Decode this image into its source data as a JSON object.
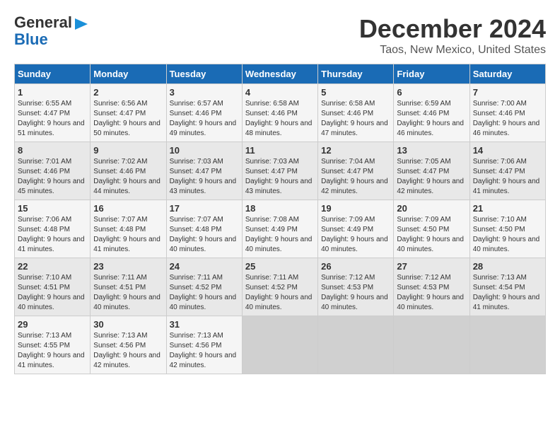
{
  "header": {
    "logo_general": "General",
    "logo_blue": "Blue",
    "title": "December 2024",
    "subtitle": "Taos, New Mexico, United States"
  },
  "calendar": {
    "columns": [
      "Sunday",
      "Monday",
      "Tuesday",
      "Wednesday",
      "Thursday",
      "Friday",
      "Saturday"
    ],
    "weeks": [
      [
        {
          "day": "1",
          "sunrise": "6:55 AM",
          "sunset": "4:47 PM",
          "daylight": "9 hours and 51 minutes."
        },
        {
          "day": "2",
          "sunrise": "6:56 AM",
          "sunset": "4:47 PM",
          "daylight": "9 hours and 50 minutes."
        },
        {
          "day": "3",
          "sunrise": "6:57 AM",
          "sunset": "4:46 PM",
          "daylight": "9 hours and 49 minutes."
        },
        {
          "day": "4",
          "sunrise": "6:58 AM",
          "sunset": "4:46 PM",
          "daylight": "9 hours and 48 minutes."
        },
        {
          "day": "5",
          "sunrise": "6:58 AM",
          "sunset": "4:46 PM",
          "daylight": "9 hours and 47 minutes."
        },
        {
          "day": "6",
          "sunrise": "6:59 AM",
          "sunset": "4:46 PM",
          "daylight": "9 hours and 46 minutes."
        },
        {
          "day": "7",
          "sunrise": "7:00 AM",
          "sunset": "4:46 PM",
          "daylight": "9 hours and 46 minutes."
        }
      ],
      [
        {
          "day": "8",
          "sunrise": "7:01 AM",
          "sunset": "4:46 PM",
          "daylight": "9 hours and 45 minutes."
        },
        {
          "day": "9",
          "sunrise": "7:02 AM",
          "sunset": "4:46 PM",
          "daylight": "9 hours and 44 minutes."
        },
        {
          "day": "10",
          "sunrise": "7:03 AM",
          "sunset": "4:47 PM",
          "daylight": "9 hours and 43 minutes."
        },
        {
          "day": "11",
          "sunrise": "7:03 AM",
          "sunset": "4:47 PM",
          "daylight": "9 hours and 43 minutes."
        },
        {
          "day": "12",
          "sunrise": "7:04 AM",
          "sunset": "4:47 PM",
          "daylight": "9 hours and 42 minutes."
        },
        {
          "day": "13",
          "sunrise": "7:05 AM",
          "sunset": "4:47 PM",
          "daylight": "9 hours and 42 minutes."
        },
        {
          "day": "14",
          "sunrise": "7:06 AM",
          "sunset": "4:47 PM",
          "daylight": "9 hours and 41 minutes."
        }
      ],
      [
        {
          "day": "15",
          "sunrise": "7:06 AM",
          "sunset": "4:48 PM",
          "daylight": "9 hours and 41 minutes."
        },
        {
          "day": "16",
          "sunrise": "7:07 AM",
          "sunset": "4:48 PM",
          "daylight": "9 hours and 41 minutes."
        },
        {
          "day": "17",
          "sunrise": "7:07 AM",
          "sunset": "4:48 PM",
          "daylight": "9 hours and 40 minutes."
        },
        {
          "day": "18",
          "sunrise": "7:08 AM",
          "sunset": "4:49 PM",
          "daylight": "9 hours and 40 minutes."
        },
        {
          "day": "19",
          "sunrise": "7:09 AM",
          "sunset": "4:49 PM",
          "daylight": "9 hours and 40 minutes."
        },
        {
          "day": "20",
          "sunrise": "7:09 AM",
          "sunset": "4:50 PM",
          "daylight": "9 hours and 40 minutes."
        },
        {
          "day": "21",
          "sunrise": "7:10 AM",
          "sunset": "4:50 PM",
          "daylight": "9 hours and 40 minutes."
        }
      ],
      [
        {
          "day": "22",
          "sunrise": "7:10 AM",
          "sunset": "4:51 PM",
          "daylight": "9 hours and 40 minutes."
        },
        {
          "day": "23",
          "sunrise": "7:11 AM",
          "sunset": "4:51 PM",
          "daylight": "9 hours and 40 minutes."
        },
        {
          "day": "24",
          "sunrise": "7:11 AM",
          "sunset": "4:52 PM",
          "daylight": "9 hours and 40 minutes."
        },
        {
          "day": "25",
          "sunrise": "7:11 AM",
          "sunset": "4:52 PM",
          "daylight": "9 hours and 40 minutes."
        },
        {
          "day": "26",
          "sunrise": "7:12 AM",
          "sunset": "4:53 PM",
          "daylight": "9 hours and 40 minutes."
        },
        {
          "day": "27",
          "sunrise": "7:12 AM",
          "sunset": "4:53 PM",
          "daylight": "9 hours and 40 minutes."
        },
        {
          "day": "28",
          "sunrise": "7:13 AM",
          "sunset": "4:54 PM",
          "daylight": "9 hours and 41 minutes."
        }
      ],
      [
        {
          "day": "29",
          "sunrise": "7:13 AM",
          "sunset": "4:55 PM",
          "daylight": "9 hours and 41 minutes."
        },
        {
          "day": "30",
          "sunrise": "7:13 AM",
          "sunset": "4:56 PM",
          "daylight": "9 hours and 42 minutes."
        },
        {
          "day": "31",
          "sunrise": "7:13 AM",
          "sunset": "4:56 PM",
          "daylight": "9 hours and 42 minutes."
        },
        null,
        null,
        null,
        null
      ]
    ]
  }
}
